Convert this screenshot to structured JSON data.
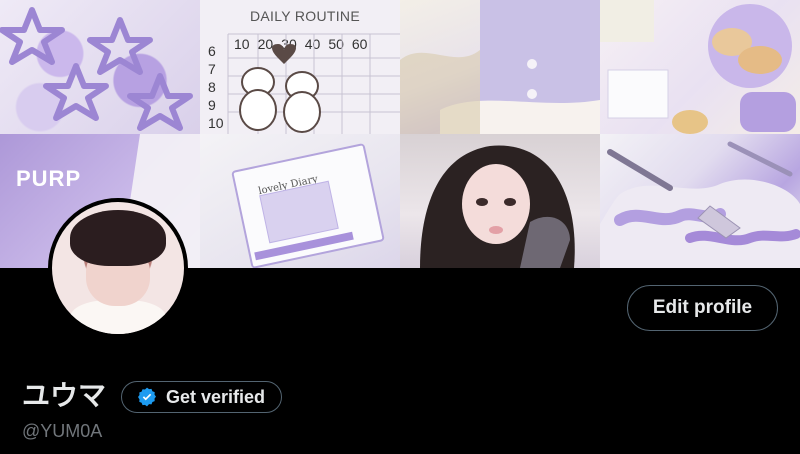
{
  "banner": {
    "tiles": [
      {
        "name": "star-clips"
      },
      {
        "name": "daily-routine",
        "title": "DAILY ROUTINE",
        "columns": [
          "10",
          "20",
          "30",
          "40",
          "50",
          "60"
        ],
        "rows": [
          "6",
          "7",
          "8",
          "9",
          "10"
        ]
      },
      {
        "name": "cardigan"
      },
      {
        "name": "coffee-scone-cakes"
      },
      {
        "name": "purple-book",
        "text": "PURP"
      },
      {
        "name": "lovely-diary",
        "label": "lovely Diary"
      },
      {
        "name": "portrait"
      },
      {
        "name": "paint-palette"
      }
    ]
  },
  "profile": {
    "display_name": "ユウマ",
    "handle": "@YUM0A",
    "edit_label": "Edit profile",
    "verify_label": "Get verified",
    "verify_icon": "verified-check-icon",
    "verify_color": "#1d9bf0"
  }
}
